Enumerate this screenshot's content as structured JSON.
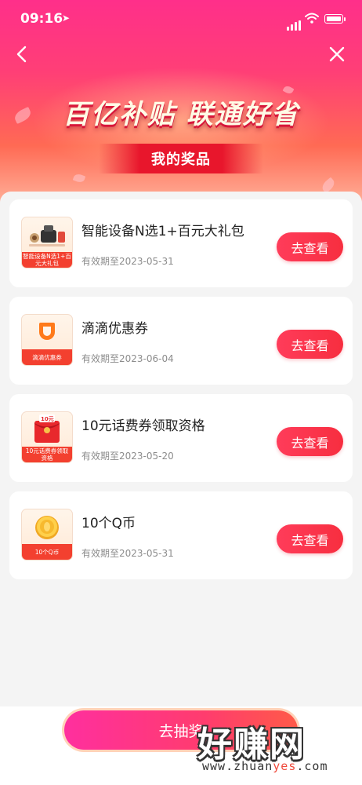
{
  "status_bar": {
    "time": "09:16"
  },
  "banner": {
    "title": "百亿补贴 联通好省",
    "subtitle": "我的奖品"
  },
  "prizes": [
    {
      "title": "智能设备N选1+百元大礼包",
      "expiry": "有效期至2023-05-31",
      "thumb_label": "智能设备N选1+百元大礼包",
      "button": "去查看",
      "icon": "gift-devices-icon"
    },
    {
      "title": "滴滴优惠券",
      "expiry": "有效期至2023-06-04",
      "thumb_label": "滴滴优惠券",
      "button": "去查看",
      "icon": "didi-logo-icon"
    },
    {
      "title": "10元话费券领取资格",
      "expiry": "有效期至2023-05-20",
      "thumb_label": "10元话费券领取资格",
      "thumb_badge": "10元",
      "button": "去查看",
      "icon": "red-envelope-icon"
    },
    {
      "title": "10个Q币",
      "expiry": "有效期至2023-05-31",
      "thumb_label": "10个Q币",
      "button": "去查看",
      "icon": "gold-coin-icon"
    }
  ],
  "bottom": {
    "draw_button": "去抽奖"
  },
  "watermark": {
    "text": "好赚网",
    "url_prefix": "www.zhuan",
    "url_highlight": "yes",
    "url_suffix": ".com"
  },
  "colors": {
    "accent": "#ff3c5a",
    "header_top": "#ff2f8a",
    "page_bg": "#f4f4f4"
  }
}
